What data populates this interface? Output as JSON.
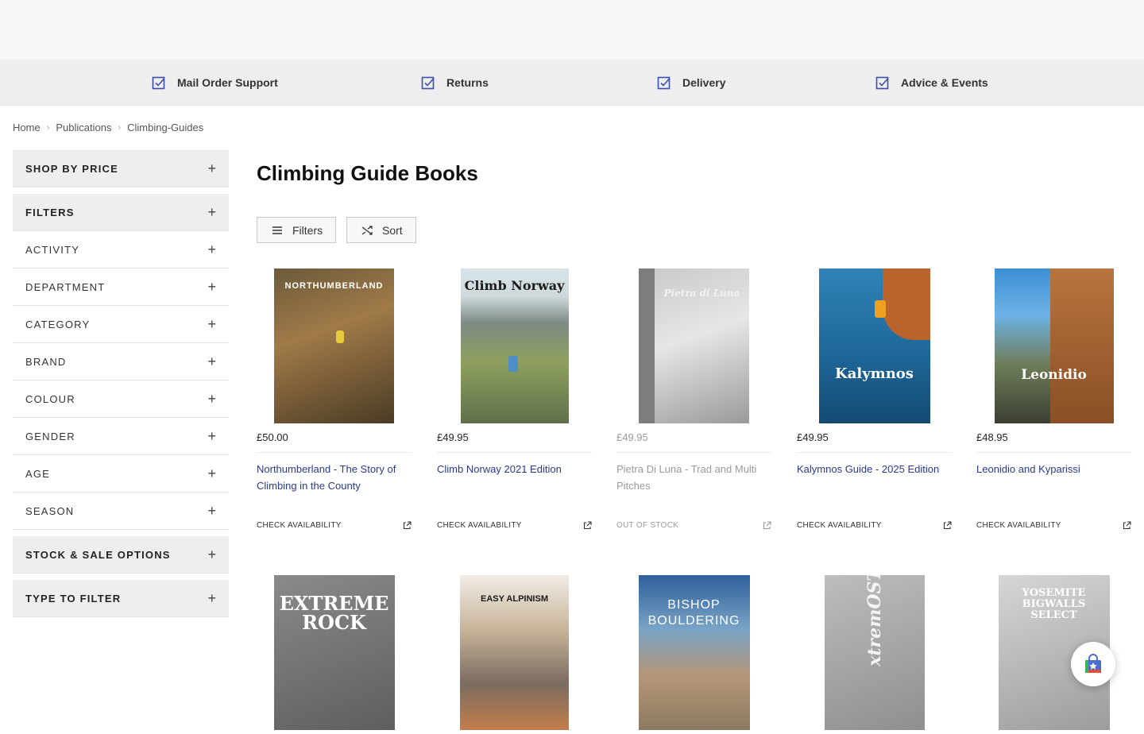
{
  "infobar": [
    {
      "label": "Mail Order Support"
    },
    {
      "label": "Returns"
    },
    {
      "label": "Delivery"
    },
    {
      "label": "Advice & Events"
    }
  ],
  "breadcrumb": [
    "Home",
    "Publications",
    "Climbing-Guides"
  ],
  "sidebar": {
    "facets": [
      "SHOP BY PRICE",
      "FILTERS",
      "ACTIVITY",
      "DEPARTMENT",
      "CATEGORY",
      "BRAND",
      "COLOUR",
      "GENDER",
      "AGE",
      "SEASON",
      "STOCK & SALE OPTIONS",
      "TYPE TO FILTER"
    ]
  },
  "page": {
    "title": "Climbing Guide Books"
  },
  "toolbar": {
    "filters_label": "Filters",
    "sort_label": "Sort"
  },
  "products": [
    {
      "price": "£50.00",
      "name": "Northumberland - The Story of Climbing in the County",
      "availability": "CHECK AVAILABILITY",
      "cover_title": "NORTHUMBERLAND"
    },
    {
      "price": "£49.95",
      "name": "Climb Norway 2021 Edition",
      "availability": "CHECK AVAILABILITY",
      "cover_title": "Climb Norway"
    },
    {
      "price": "£49.95",
      "name": "Pietra Di Luna - Trad and Multi Pitches",
      "availability": "OUT OF STOCK",
      "cover_title": "Pietra di Luna"
    },
    {
      "price": "£49.95",
      "name": "Kalymnos Guide - 2025 Edition",
      "availability": "CHECK AVAILABILITY",
      "cover_title": "Kalymnos"
    },
    {
      "price": "£48.95",
      "name": "Leonidio and Kyparissi",
      "availability": "CHECK AVAILABILITY",
      "cover_title": "Leonidio"
    }
  ],
  "products_row2": [
    {
      "cover_title": "EXTREME ROCK"
    },
    {
      "cover_title": "EASY ALPINISM"
    },
    {
      "cover_title": "BISHOP BOULDERING"
    },
    {
      "cover_title": "xtremOST"
    },
    {
      "cover_title": "YOSEMITE BIGWALLS SELECT"
    }
  ],
  "colors": {
    "accent": "#2a3a8c",
    "panel": "#eeeeef",
    "check": "#3d4fa8"
  }
}
